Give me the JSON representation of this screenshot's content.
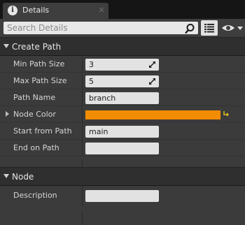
{
  "tab": {
    "icon": "info-icon",
    "label": "Details",
    "close": "×"
  },
  "search": {
    "placeholder": "Search Details"
  },
  "toolbar": {
    "search_icon": "magnifier-icon",
    "view_icon": "list-icon",
    "visibility_icon": "eye-icon"
  },
  "sections": {
    "create_path": {
      "title": "Create Path",
      "rows": {
        "min_path_size": {
          "label": "Min Path Size",
          "value": "3"
        },
        "max_path_size": {
          "label": "Max Path Size",
          "value": "5"
        },
        "path_name": {
          "label": "Path Name",
          "value": "branch"
        },
        "node_color": {
          "label": "Node Color",
          "color": "#f28c00"
        },
        "start_from_path": {
          "label": "Start from Path",
          "value": "main"
        },
        "end_on_path": {
          "label": "End on Path",
          "value": ""
        }
      }
    },
    "node": {
      "title": "Node",
      "rows": {
        "description": {
          "label": "Description",
          "value": ""
        }
      }
    }
  }
}
